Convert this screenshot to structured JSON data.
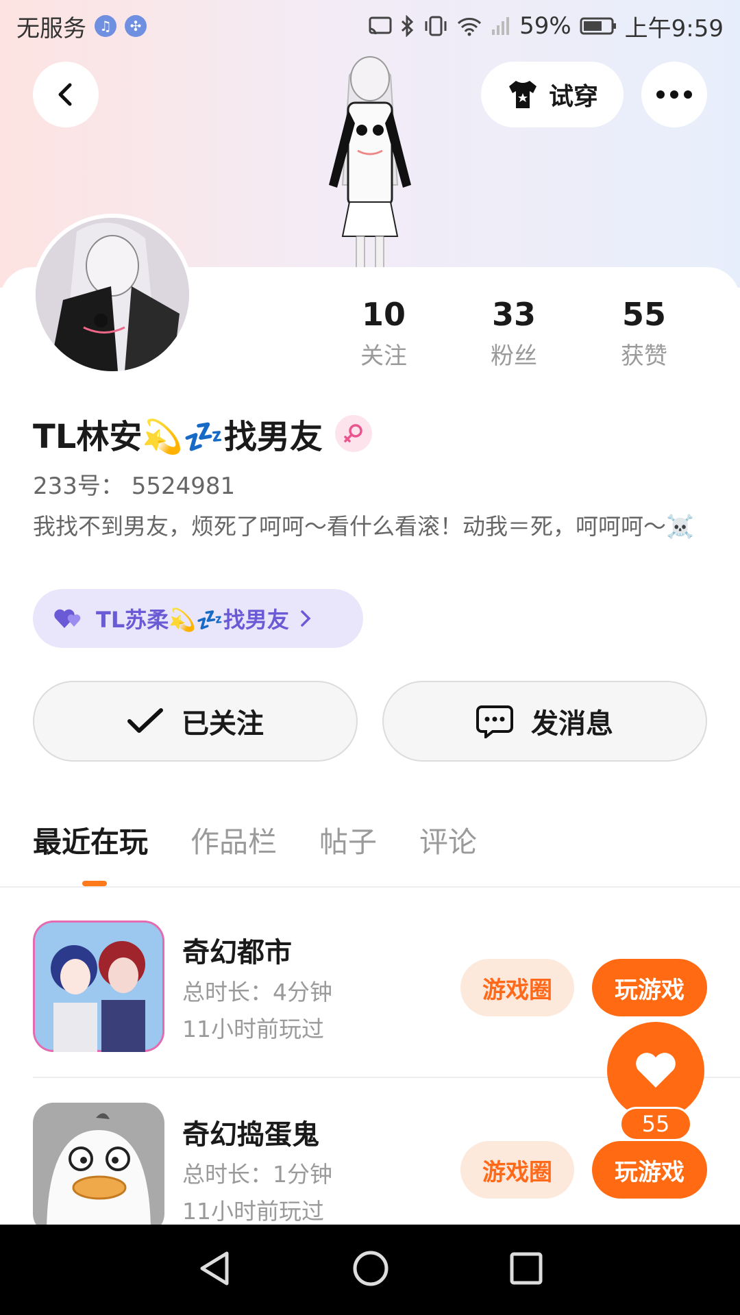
{
  "status_bar": {
    "carrier": "无服务",
    "battery": "59%",
    "time": "上午9:59"
  },
  "header": {
    "try_on_label": "试穿"
  },
  "profile": {
    "stats": [
      {
        "value": "10",
        "label": "关注"
      },
      {
        "value": "33",
        "label": "粉丝"
      },
      {
        "value": "55",
        "label": "获赞"
      }
    ],
    "nickname": "TL林安💫💤找男友",
    "uid": "233号：  5524981",
    "bio": "我找不到男友，烦死了呵呵～看什么看滚！动我＝死，呵呵呵～☠️",
    "linked_user": "TL苏柔💫💤找男友"
  },
  "actions": {
    "follow_label": "已关注",
    "message_label": "发消息"
  },
  "tabs": [
    "最近在玩",
    "作品栏",
    "帖子",
    "评论"
  ],
  "games": [
    {
      "title": "奇幻都市",
      "duration": "总时长：4分钟",
      "last_played": "11小时前玩过",
      "circle_label": "游戏圈",
      "play_label": "玩游戏"
    },
    {
      "title": "奇幻捣蛋鬼",
      "duration": "总时长：1分钟",
      "last_played": "11小时前玩过",
      "circle_label": "游戏圈",
      "play_label": "玩游戏"
    }
  ],
  "like_fab": {
    "count": "55"
  },
  "colors": {
    "accent": "#ff6a13",
    "accent_light": "#fde8dc",
    "chip_bg": "#e9e6fb",
    "chip_text": "#6b5ad6"
  }
}
